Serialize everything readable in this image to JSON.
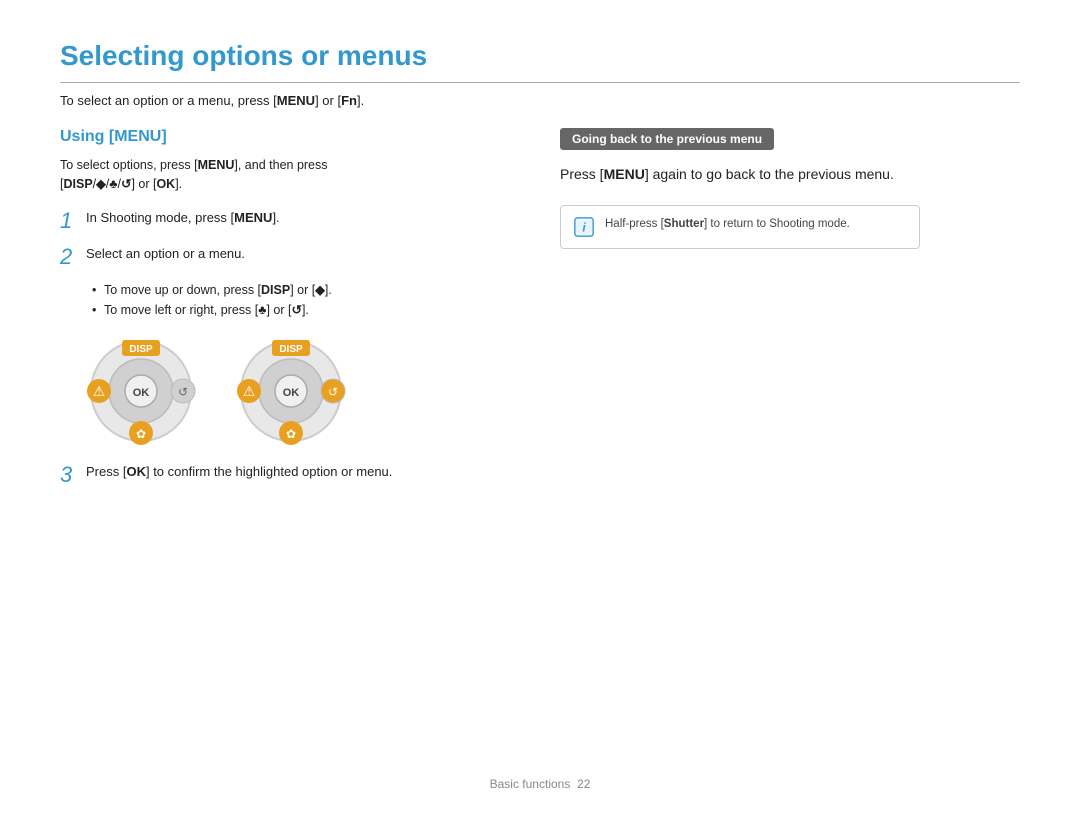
{
  "page": {
    "title": "Selecting options or menus",
    "top_desc_prefix": "To select an option or a menu, press [",
    "top_desc_menu": "MENU",
    "top_desc_mid": "] or [",
    "top_desc_fn": "Fn",
    "top_desc_suffix": "].",
    "footer_label": "Basic functions",
    "footer_page": "22"
  },
  "left": {
    "section_title": "Using [MENU]",
    "desc_prefix": "To select options, press [",
    "desc_menu": "MENU",
    "desc_mid": "], and then press\n[",
    "desc_icons": "DISP/♦/♣/↺",
    "desc_suffix": "] or [",
    "desc_ok": "OK",
    "desc_end": "].",
    "step1_text_prefix": "In Shooting mode, press [",
    "step1_menu": "MENU",
    "step1_suffix": "].",
    "step2_text": "Select an option or a menu.",
    "bullet1_prefix": "To move up or down, press [",
    "bullet1_disp": "DISP",
    "bullet1_mid": "] or [",
    "bullet1_icon": "♦",
    "bullet1_suffix": "].",
    "bullet2_prefix": "To move left or right, press [",
    "bullet2_icon": "♣",
    "bullet2_mid": "] or [",
    "bullet2_icon2": "↺",
    "bullet2_suffix": "].",
    "step3_prefix": "Press [",
    "step3_ok": "OK",
    "step3_suffix": "] to confirm the highlighted option or menu."
  },
  "right": {
    "tab_label": "Going back to the previous menu",
    "press_prefix": "Press [",
    "press_menu": "MENU",
    "press_suffix": "] again to go back to the previous menu.",
    "note_text_prefix": "Half-press [",
    "note_shutter": "Shutter",
    "note_text_suffix": "] to return to Shooting mode."
  },
  "disp_label": "DISP",
  "ok_label": "OK"
}
